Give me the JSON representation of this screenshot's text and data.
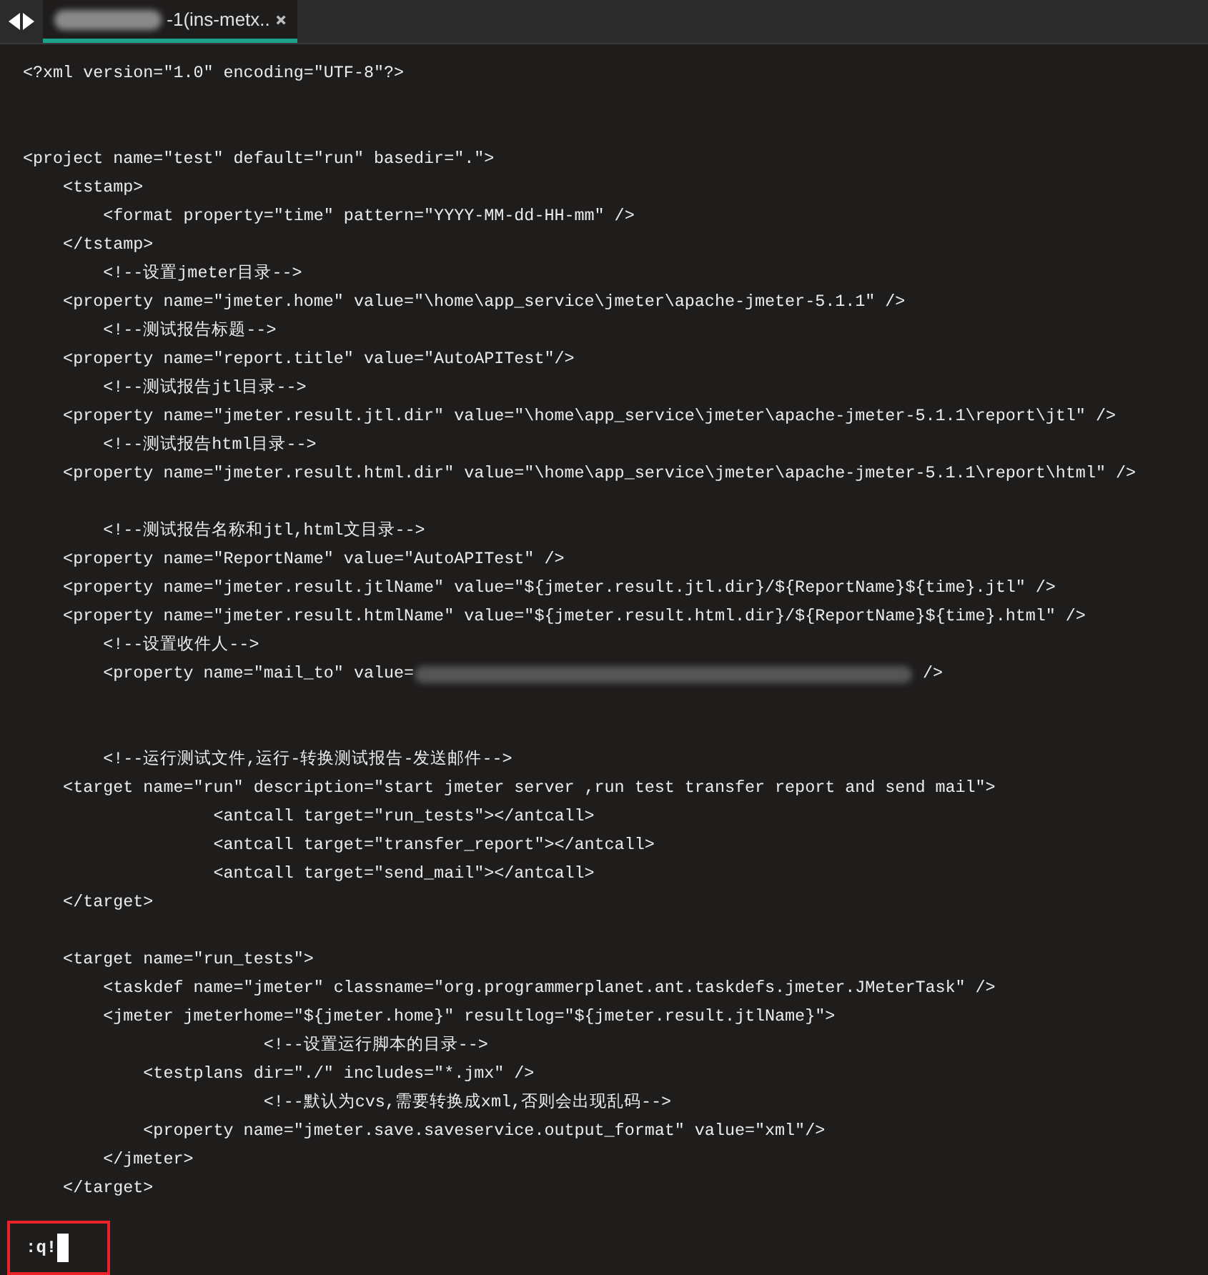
{
  "tab": {
    "title": "-1(ins-metx..",
    "selected": true
  },
  "lines": [
    {
      "kind": "code",
      "text": "<?xml version=\"1.0\" encoding=\"UTF-8\"?>"
    },
    {
      "kind": "blank"
    },
    {
      "kind": "blank"
    },
    {
      "kind": "code",
      "text": "<project name=\"test\" default=\"run\" basedir=\".\">"
    },
    {
      "kind": "code",
      "text": "    <tstamp>"
    },
    {
      "kind": "code",
      "text": "        <format property=\"time\" pattern=\"YYYY-MM-dd-HH-mm\" />"
    },
    {
      "kind": "code",
      "text": "    </tstamp>"
    },
    {
      "kind": "code",
      "text": "        <!--设置jmeter目录-->"
    },
    {
      "kind": "code",
      "text": "    <property name=\"jmeter.home\" value=\"\\home\\app_service\\jmeter\\apache-jmeter-5.1.1\" />"
    },
    {
      "kind": "code",
      "text": "        <!--测试报告标题-->"
    },
    {
      "kind": "code",
      "text": "    <property name=\"report.title\" value=\"AutoAPITest\"/>"
    },
    {
      "kind": "code",
      "text": "        <!--测试报告jtl目录-->"
    },
    {
      "kind": "code",
      "text": "    <property name=\"jmeter.result.jtl.dir\" value=\"\\home\\app_service\\jmeter\\apache-jmeter-5.1.1\\report\\jtl\" />"
    },
    {
      "kind": "code",
      "text": "        <!--测试报告html目录-->"
    },
    {
      "kind": "code",
      "text": "    <property name=\"jmeter.result.html.dir\" value=\"\\home\\app_service\\jmeter\\apache-jmeter-5.1.1\\report\\html\" />"
    },
    {
      "kind": "blank"
    },
    {
      "kind": "code",
      "text": "        <!--测试报告名称和jtl,html文目录-->"
    },
    {
      "kind": "code",
      "text": "    <property name=\"ReportName\" value=\"AutoAPITest\" />"
    },
    {
      "kind": "code",
      "text": "    <property name=\"jmeter.result.jtlName\" value=\"${jmeter.result.jtl.dir}/${ReportName}${time}.jtl\" />"
    },
    {
      "kind": "code",
      "text": "    <property name=\"jmeter.result.htmlName\" value=\"${jmeter.result.html.dir}/${ReportName}${time}.html\" />"
    },
    {
      "kind": "code",
      "text": "        <!--设置收件人-->"
    },
    {
      "kind": "redacted",
      "text": "        <property name=\"mail_to\" value=",
      "after": "/>"
    },
    {
      "kind": "blank"
    },
    {
      "kind": "blank"
    },
    {
      "kind": "code",
      "text": "        <!--运行测试文件,运行-转换测试报告-发送邮件-->"
    },
    {
      "kind": "code",
      "text": "    <target name=\"run\" description=\"start jmeter server ,run test transfer report and send mail\">"
    },
    {
      "kind": "code",
      "text": "                   <antcall target=\"run_tests\"></antcall>"
    },
    {
      "kind": "code",
      "text": "                   <antcall target=\"transfer_report\"></antcall>"
    },
    {
      "kind": "code",
      "text": "                   <antcall target=\"send_mail\"></antcall>"
    },
    {
      "kind": "code",
      "text": "    </target>"
    },
    {
      "kind": "blank"
    },
    {
      "kind": "code",
      "text": "    <target name=\"run_tests\">"
    },
    {
      "kind": "code",
      "text": "        <taskdef name=\"jmeter\" classname=\"org.programmerplanet.ant.taskdefs.jmeter.JMeterTask\" />"
    },
    {
      "kind": "code",
      "text": "        <jmeter jmeterhome=\"${jmeter.home}\" resultlog=\"${jmeter.result.jtlName}\">"
    },
    {
      "kind": "code",
      "text": "                        <!--设置运行脚本的目录-->"
    },
    {
      "kind": "code",
      "text": "            <testplans dir=\"./\" includes=\"*.jmx\" />"
    },
    {
      "kind": "code",
      "text": "                        <!--默认为cvs,需要转换成xml,否则会出现乱码-->"
    },
    {
      "kind": "code",
      "text": "            <property name=\"jmeter.save.saveservice.output_format\" value=\"xml\"/>"
    },
    {
      "kind": "code",
      "text": "        </jmeter>"
    },
    {
      "kind": "code",
      "text": "    </target>"
    }
  ],
  "command_line": {
    "text": ":q!",
    "highlighted": true
  }
}
